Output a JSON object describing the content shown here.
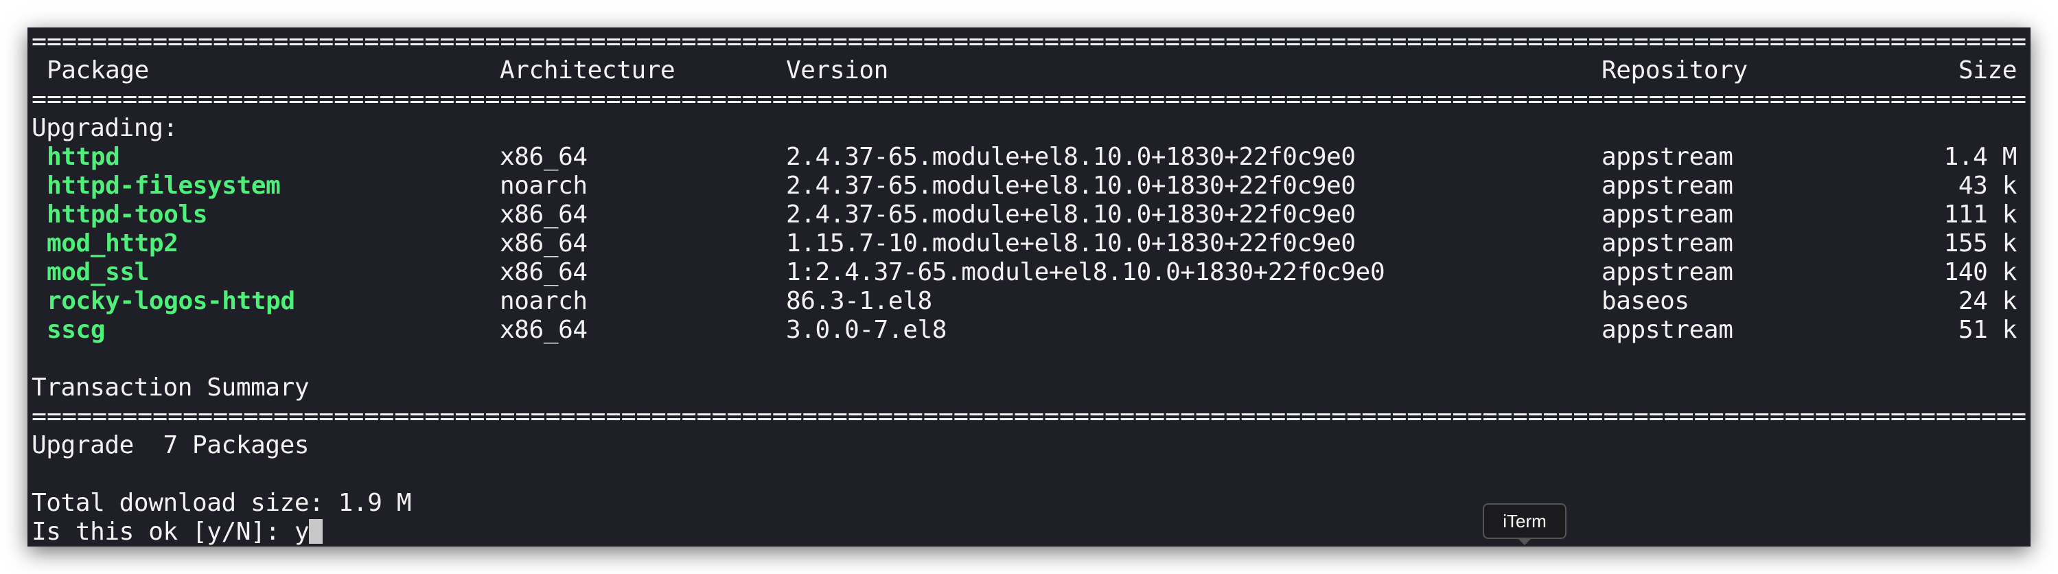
{
  "separator": "====================================================================================================================================",
  "header": {
    "package": "Package",
    "arch": "Architecture",
    "version": "Version",
    "repo": "Repository",
    "size": "Size"
  },
  "section": "Upgrading:",
  "packages": [
    {
      "name": "httpd",
      "arch": "x86_64",
      "version": "2.4.37-65.module+el8.10.0+1830+22f0c9e0",
      "repo": "appstream",
      "size": "1.4 M"
    },
    {
      "name": "httpd-filesystem",
      "arch": "noarch",
      "version": "2.4.37-65.module+el8.10.0+1830+22f0c9e0",
      "repo": "appstream",
      "size": "43 k"
    },
    {
      "name": "httpd-tools",
      "arch": "x86_64",
      "version": "2.4.37-65.module+el8.10.0+1830+22f0c9e0",
      "repo": "appstream",
      "size": "111 k"
    },
    {
      "name": "mod_http2",
      "arch": "x86_64",
      "version": "1.15.7-10.module+el8.10.0+1830+22f0c9e0",
      "repo": "appstream",
      "size": "155 k"
    },
    {
      "name": "mod_ssl",
      "arch": "x86_64",
      "version": "1:2.4.37-65.module+el8.10.0+1830+22f0c9e0",
      "repo": "appstream",
      "size": "140 k"
    },
    {
      "name": "rocky-logos-httpd",
      "arch": "noarch",
      "version": "86.3-1.el8",
      "repo": "baseos",
      "size": "24 k"
    },
    {
      "name": "sscg",
      "arch": "x86_64",
      "version": "3.0.0-7.el8",
      "repo": "appstream",
      "size": "51 k"
    }
  ],
  "summary_title": "Transaction Summary",
  "upgrade_line": "Upgrade  7 Packages",
  "total_download": "Total download size: 1.9 M",
  "prompt": "Is this ok [y/N]: ",
  "input": "y",
  "tooltip": "iTerm",
  "colors": {
    "background": "#1f1f28",
    "package": "#4ef07a",
    "text": "#f2f2f2"
  }
}
